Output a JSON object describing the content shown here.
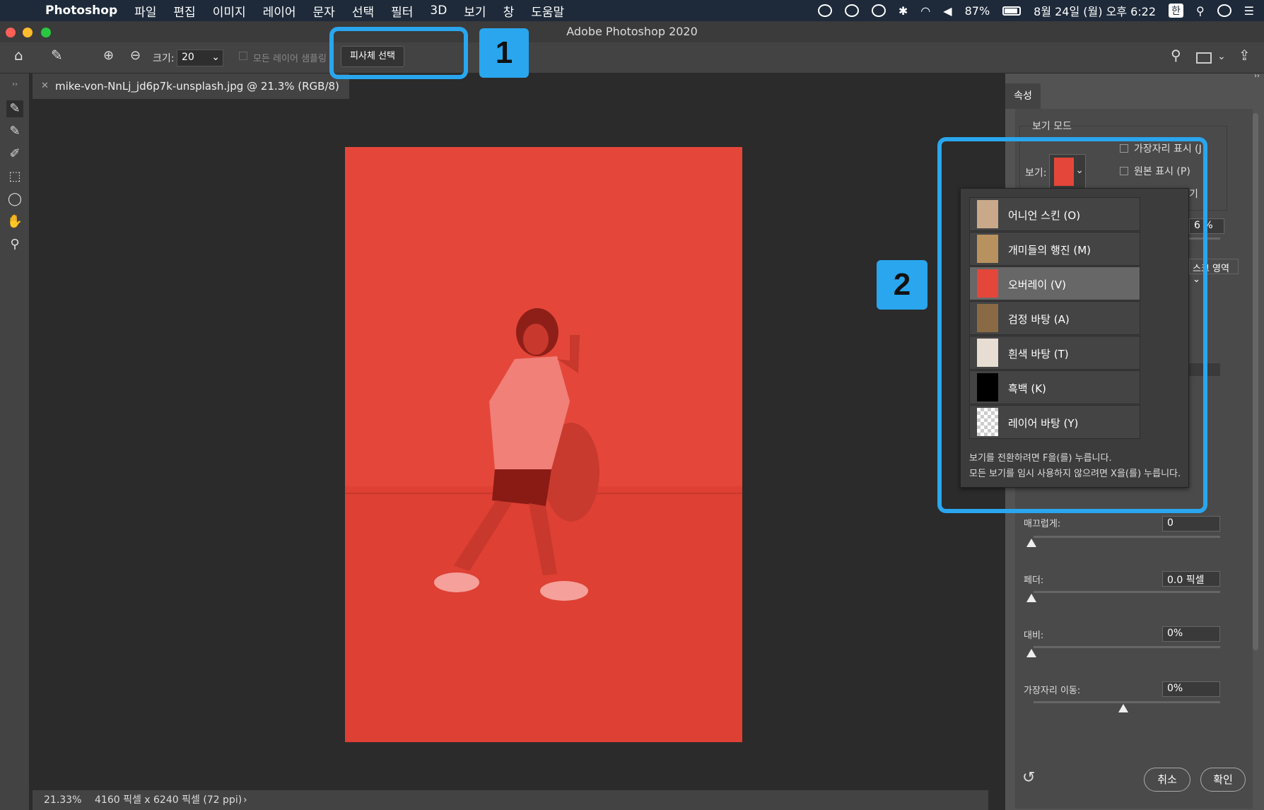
{
  "menubar": {
    "app_name": "Photoshop",
    "items": [
      "파일",
      "편집",
      "이미지",
      "레이어",
      "문자",
      "선택",
      "필터",
      "3D",
      "보기",
      "창",
      "도움말"
    ],
    "battery": "87%",
    "datetime": "8월 24일 (월) 오후 6:22",
    "input_lang": "한"
  },
  "window": {
    "title": "Adobe Photoshop 2020"
  },
  "options": {
    "size_label": "크기:",
    "size_value": "20",
    "sample_all_layers": "모든 레이어 샘플링",
    "select_subject": "피사체 선택"
  },
  "document": {
    "tab_title": "mike-von-NnLj_jd6p7k-unsplash.jpg @ 21.3% (RGB/8)",
    "zoom": "21.33%",
    "dimensions": "4160 픽셀 x 6240 픽셀 (72 ppi)"
  },
  "properties": {
    "tab": "속성",
    "view_mode_section": "보기 모드",
    "view_label": "보기:",
    "show_edge": "가장자리 표시 (J",
    "show_original": "원본 표시 (P)",
    "smooth_label": "매끄럽게:",
    "smooth_value": "0",
    "feather_label": "페더:",
    "feather_value": "0.0 픽셀",
    "contrast_label": "대비:",
    "contrast_value": "0%",
    "shift_edge_label": "가장자리 이동:",
    "shift_edge_value": "0%",
    "partial_pct": "6 %",
    "partial_dropdown": "스크 영역",
    "partial_right": "기",
    "cancel": "취소",
    "ok": "확인"
  },
  "view_menu": {
    "items": [
      {
        "label": "어니언 스킨 (O)",
        "thumb_color": "#c9a98a"
      },
      {
        "label": "개미들의 행진 (M)",
        "thumb_color": "#b8925e"
      },
      {
        "label": "오버레이 (V)",
        "thumb_color": "#e4473a",
        "selected": true
      },
      {
        "label": "검정 바탕 (A)",
        "thumb_color": "#8a6a45"
      },
      {
        "label": "흰색 바탕 (T)",
        "thumb_color": "#e8ddd3"
      },
      {
        "label": "흑백 (K)",
        "thumb_color": "#000000"
      },
      {
        "label": "레이어 바탕 (Y)",
        "thumb_color": "checker"
      }
    ],
    "hint1": "보기를 전환하려면 F을(를) 누릅니다.",
    "hint2": "모든 보기를 임시 사용하지 않으려면 X을(를) 누릅니다."
  },
  "callouts": [
    "1",
    "2"
  ],
  "colors": {
    "overlay": "#e4473a",
    "callout": "#2aa6ee"
  }
}
